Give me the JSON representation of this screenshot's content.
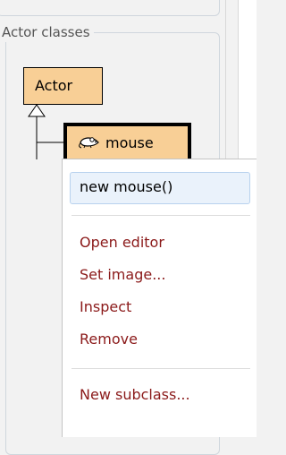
{
  "panel": {
    "title": "Actor classes"
  },
  "classes": {
    "root": "Actor",
    "child": "mouse",
    "child_icon": "mouse-icon"
  },
  "menu": {
    "items": [
      {
        "label": "new mouse()",
        "highlighted": true
      },
      {
        "label": "Open editor"
      },
      {
        "label": "Set image..."
      },
      {
        "label": "Inspect"
      },
      {
        "label": "Remove"
      },
      {
        "label": "New subclass..."
      }
    ]
  },
  "colors": {
    "class_box": "#f8cf96",
    "menu_action_text": "#8b1a1a",
    "menu_highlight": "#eaf2fb"
  }
}
